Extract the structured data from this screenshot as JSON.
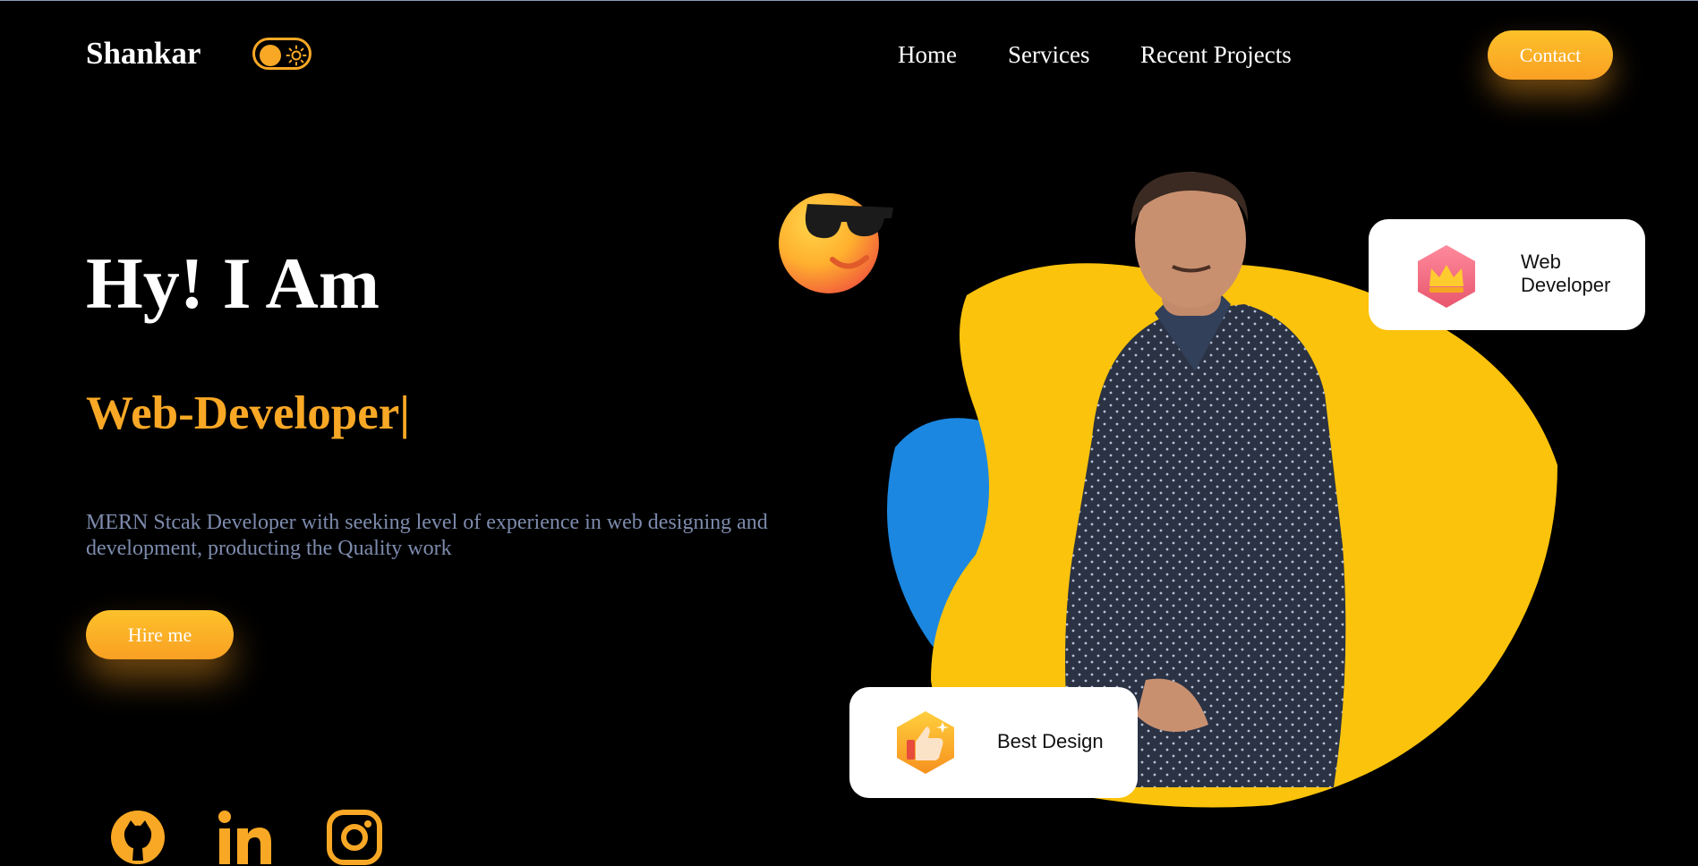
{
  "header": {
    "logo": "Shankar",
    "theme_toggle_icon": "sun-icon",
    "nav": [
      "Home",
      "Services",
      "Recent Projects"
    ],
    "contact_label": "Contact"
  },
  "hero": {
    "greeting": "Hy! I Am",
    "role": "Web-Developer|",
    "description": "MERN Stcak Developer with seeking level of experience in web designing and development, producting the Quality work",
    "hire_label": "Hire me"
  },
  "cards": {
    "web_developer": {
      "label": "Web Developer",
      "icon": "crown-icon"
    },
    "best_design": {
      "label": "Best Design",
      "icon": "thumbs-up-icon"
    }
  },
  "social": [
    {
      "icon": "github-icon"
    },
    {
      "icon": "linkedin-icon"
    },
    {
      "icon": "instagram-icon"
    }
  ],
  "colors": {
    "accent": "#f9a825",
    "background": "#000000",
    "description_text": "#7d8bad",
    "blob_yellow": "#fcc30c",
    "blob_blue": "#1b87e0"
  }
}
